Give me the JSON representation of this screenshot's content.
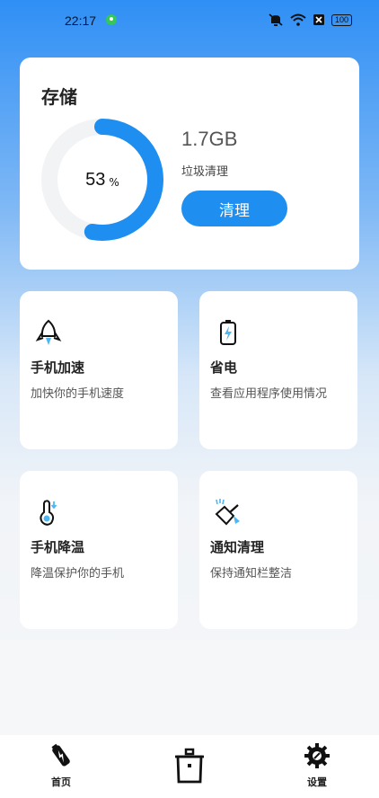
{
  "status_bar": {
    "time": "22:17",
    "battery": "100"
  },
  "storage": {
    "title": "存储",
    "percent": "53",
    "percent_symbol": "%",
    "used_fraction": 0.53,
    "junk_size": "1.7GB",
    "junk_label": "垃圾清理",
    "clean_button": "清理",
    "accent_color": "#1e8ff0"
  },
  "features": [
    {
      "icon": "rocket-icon",
      "title": "手机加速",
      "subtitle": "加快你的手机速度"
    },
    {
      "icon": "battery-icon",
      "title": "省电",
      "subtitle": "查看应用程序使用情况"
    },
    {
      "icon": "thermometer-icon",
      "title": "手机降温",
      "subtitle": "降温保护你的手机"
    },
    {
      "icon": "broom-icon",
      "title": "通知清理",
      "subtitle": "保持通知栏整洁"
    }
  ],
  "bottom_nav": [
    {
      "icon": "home-icon",
      "label": "首页"
    },
    {
      "icon": "trash-icon",
      "label": ""
    },
    {
      "icon": "gear-icon",
      "label": "设置"
    }
  ]
}
